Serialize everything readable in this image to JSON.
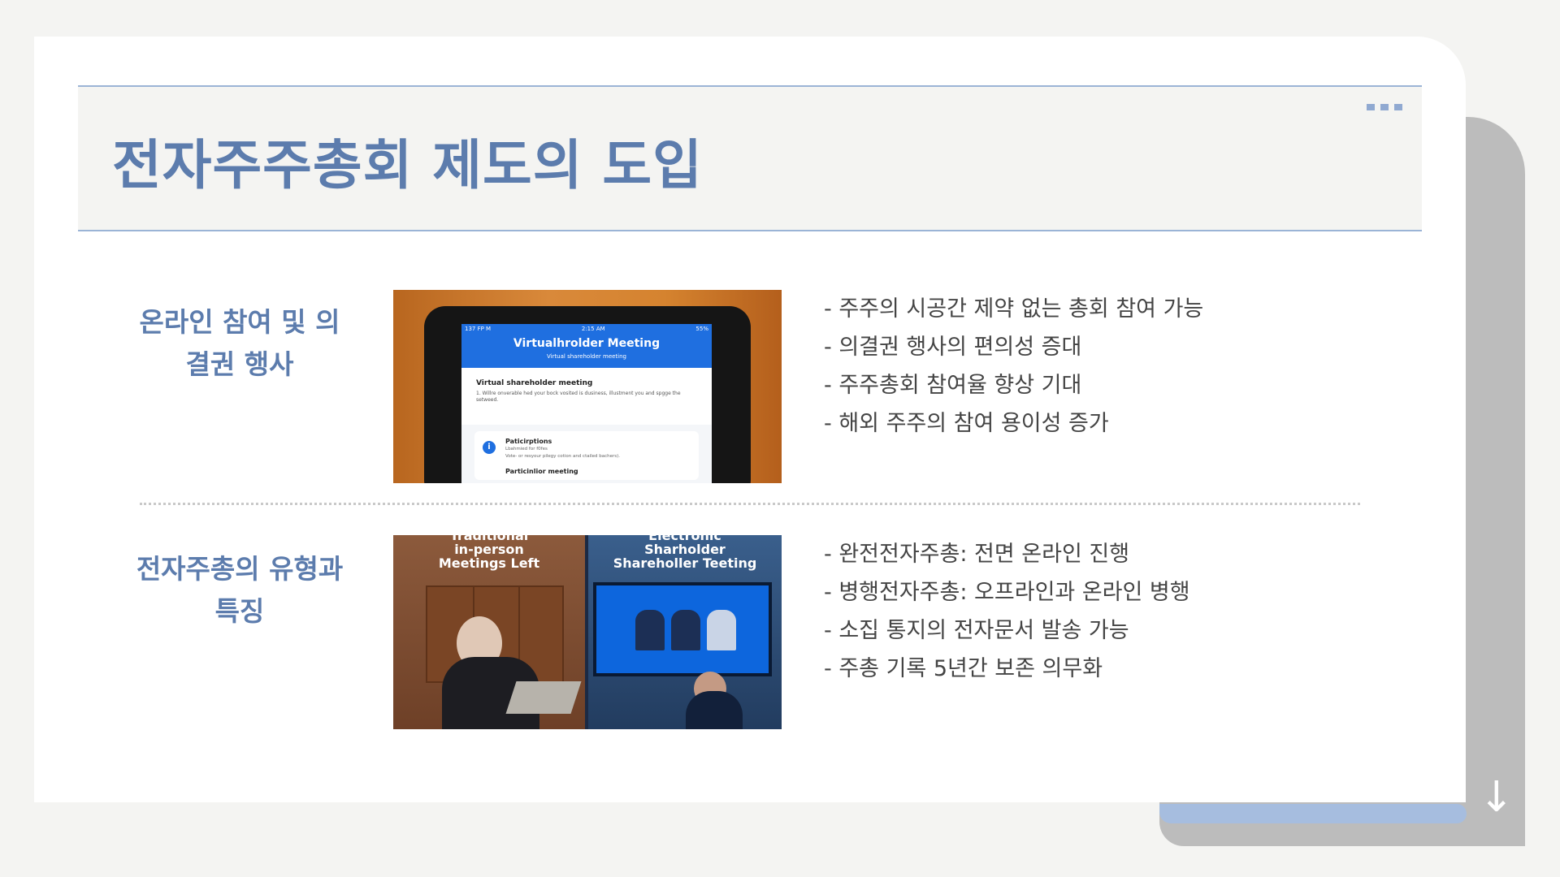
{
  "slide": {
    "title": "전자주주총회 제도의 도입"
  },
  "sections": [
    {
      "title_line1": "온라인 참여 및 의",
      "title_line2": "결권 행사",
      "bullets": [
        "- 주주의 시공간 제약 없는 총회 참여 가능",
        "- 의결권 행사의 편의성 증대",
        "- 주주총회 참여율 향상 기대",
        "- 해외 주주의 참여 용이성 증가"
      ],
      "image": {
        "status_left": "137 FP M",
        "status_mid": "2:15 AM",
        "status_right": "55%",
        "app_title": "Virtualhrolder Meeting",
        "app_subtitle": "Virtual shareholder meeting",
        "body_heading": "Virtual shareholder meeting",
        "body_text": "1. Willre onverable hed your bock vosited is dusiness, illustment you and spgge the setweed.",
        "card_title": "Paticirptions",
        "card_text1": "Lbahmied for f0fes",
        "card_text2": "Vote- or resyour pilegy cotion and ctailed bachers).",
        "card_next": "Particinlior meeting"
      }
    },
    {
      "title_line1": "전자주총의 유형과",
      "title_line2": "특징",
      "bullets": [
        "- 완전전자주총: 전면 온라인 진행",
        "- 병행전자주총: 오프라인과 온라인 병행",
        "- 소집 통지의 전자문서 발송 가능",
        "- 주총 기록 5년간 보존 의무화"
      ],
      "image": {
        "left_caption_1": "Traditional",
        "left_caption_2": "in-person",
        "left_caption_3": "Meetings Left",
        "right_caption_1": "Electronic",
        "right_caption_2": "Sharholder",
        "right_caption_3": "Shareholler Teeting"
      }
    }
  ],
  "colors": {
    "accent": "#5c7cad",
    "rule": "#9bb4d6",
    "page_bg": "#f4f4f2"
  },
  "icons": [
    "more-dots-icon",
    "down-arrow-icon"
  ]
}
